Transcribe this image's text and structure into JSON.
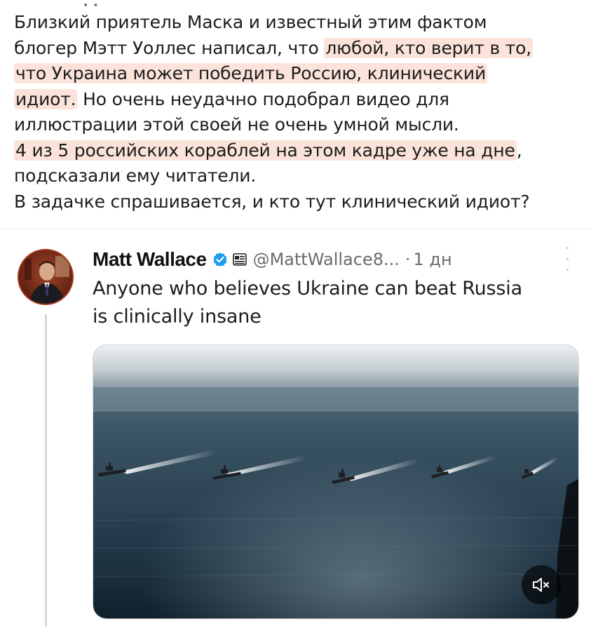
{
  "post": {
    "lines": [
      [
        {
          "text": "Близкий приятель Маска и известный этим фактом",
          "hl": false
        }
      ],
      [
        {
          "text": "блогер Мэтт Уоллес написал, что ",
          "hl": false
        },
        {
          "text": "любой, кто верит в то,",
          "hl": true
        }
      ],
      [
        {
          "text": "что Украина может победить Россию, клинический",
          "hl": true
        }
      ],
      [
        {
          "text": "идиот.",
          "hl": true
        },
        {
          "text": " Но очень неудачно подобрал видео для",
          "hl": false
        }
      ],
      [
        {
          "text": "иллюстрации этой своей не очень умной мысли.",
          "hl": false
        }
      ],
      [
        {
          "text": "4 из 5 российских кораблей на этом кадре уже на дне",
          "hl": true
        },
        {
          "text": ",",
          "hl": false
        }
      ],
      [
        {
          "text": "подсказали ему читатели.",
          "hl": false
        }
      ],
      [
        {
          "text": "В задачке спрашивается, и кто тут клинический идиот?",
          "hl": false
        }
      ]
    ],
    "highlight_color": "#fbe3d9"
  },
  "tweet": {
    "author_name": "Matt Wallace",
    "handle": "@MattWallace8...",
    "separator": "·",
    "time": "1 дн",
    "verified_color": "#1d9bf0",
    "text_line1": "Anyone who believes Ukraine can beat Russia",
    "text_line2": "is clinically insane",
    "media": {
      "type": "video",
      "ships_count": 5,
      "mute_icon": "speaker-muted-icon"
    }
  }
}
